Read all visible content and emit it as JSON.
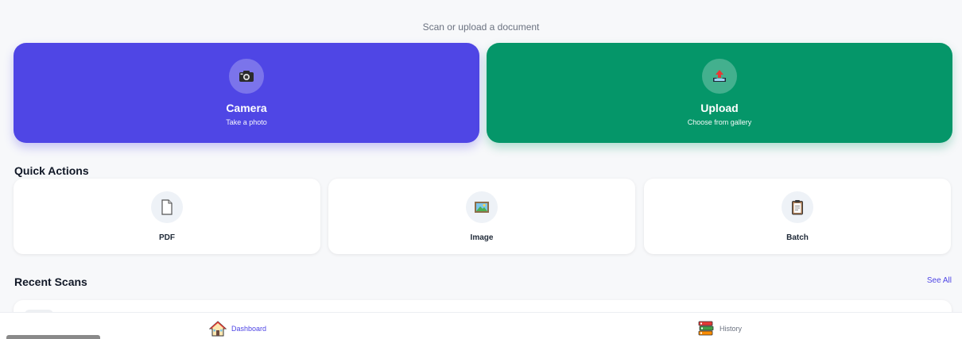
{
  "header": {
    "subtitle": "Scan or upload a document"
  },
  "hero": {
    "camera": {
      "title": "Camera",
      "subtitle": "Take a photo",
      "icon": "camera-icon",
      "color": "#4f46e5"
    },
    "upload": {
      "title": "Upload",
      "subtitle": "Choose from gallery",
      "icon": "upload-tray-icon",
      "color": "#059669"
    }
  },
  "quick_actions": {
    "title": "Quick Actions",
    "items": [
      {
        "label": "PDF",
        "icon": "document-icon"
      },
      {
        "label": "Image",
        "icon": "picture-icon"
      },
      {
        "label": "Batch",
        "icon": "clipboard-icon"
      }
    ]
  },
  "recent": {
    "title": "Recent Scans",
    "see_all": "See All"
  },
  "nav": {
    "items": [
      {
        "label": "Dashboard",
        "icon": "home-icon",
        "active": true
      },
      {
        "label": "History",
        "icon": "books-icon",
        "active": false
      }
    ]
  },
  "colors": {
    "accent": "#4f46e5",
    "success": "#059669"
  }
}
